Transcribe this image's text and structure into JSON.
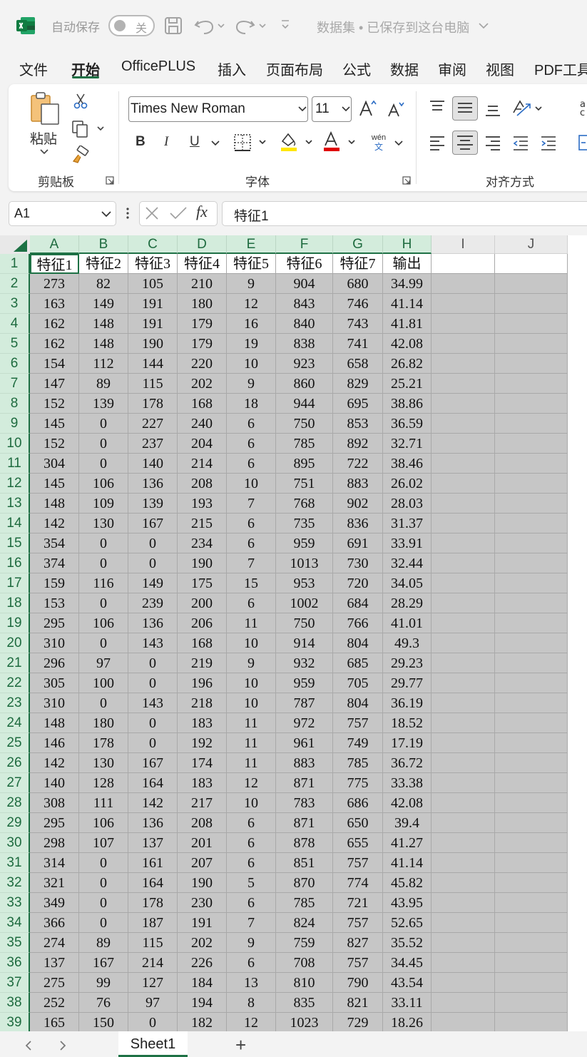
{
  "titlebar": {
    "app_icon": "excel-logo-icon",
    "autosave_label": "自动保存",
    "toggle_label": "关",
    "doc_title": "数据集 • 已保存到这台电脑"
  },
  "menu_tabs": [
    "文件",
    "开始",
    "OfficePLUS",
    "插入",
    "页面布局",
    "公式",
    "数据",
    "审阅",
    "视图",
    "PDF工具"
  ],
  "active_tab": "开始",
  "ribbon": {
    "clipboard": {
      "paste_label": "粘贴",
      "group_label": "剪贴板"
    },
    "font": {
      "font_name": "Times New Roman",
      "font_size": "11",
      "bold": "B",
      "italic": "I",
      "underline": "U",
      "phonetic_top": "wén",
      "phonetic_bottom": "文",
      "group_label": "字体"
    },
    "alignment": {
      "group_label": "对齐方式"
    },
    "accent_color": "#1e7145",
    "highlight_color": "#ffe600",
    "font_color": "#e00000"
  },
  "formula_bar": {
    "name_box": "A1",
    "fx_label": "fx",
    "formula": "特征1"
  },
  "grid": {
    "columns": [
      "A",
      "B",
      "C",
      "D",
      "E",
      "F",
      "G",
      "H",
      "I",
      "J"
    ],
    "header_row": [
      "特征1",
      "特征2",
      "特征3",
      "特征4",
      "特征5",
      "特征6",
      "特征7",
      "输出"
    ],
    "rows": [
      [
        "273",
        "82",
        "105",
        "210",
        "9",
        "904",
        "680",
        "34.99"
      ],
      [
        "163",
        "149",
        "191",
        "180",
        "12",
        "843",
        "746",
        "41.14"
      ],
      [
        "162",
        "148",
        "191",
        "179",
        "16",
        "840",
        "743",
        "41.81"
      ],
      [
        "162",
        "148",
        "190",
        "179",
        "19",
        "838",
        "741",
        "42.08"
      ],
      [
        "154",
        "112",
        "144",
        "220",
        "10",
        "923",
        "658",
        "26.82"
      ],
      [
        "147",
        "89",
        "115",
        "202",
        "9",
        "860",
        "829",
        "25.21"
      ],
      [
        "152",
        "139",
        "178",
        "168",
        "18",
        "944",
        "695",
        "38.86"
      ],
      [
        "145",
        "0",
        "227",
        "240",
        "6",
        "750",
        "853",
        "36.59"
      ],
      [
        "152",
        "0",
        "237",
        "204",
        "6",
        "785",
        "892",
        "32.71"
      ],
      [
        "304",
        "0",
        "140",
        "214",
        "6",
        "895",
        "722",
        "38.46"
      ],
      [
        "145",
        "106",
        "136",
        "208",
        "10",
        "751",
        "883",
        "26.02"
      ],
      [
        "148",
        "109",
        "139",
        "193",
        "7",
        "768",
        "902",
        "28.03"
      ],
      [
        "142",
        "130",
        "167",
        "215",
        "6",
        "735",
        "836",
        "31.37"
      ],
      [
        "354",
        "0",
        "0",
        "234",
        "6",
        "959",
        "691",
        "33.91"
      ],
      [
        "374",
        "0",
        "0",
        "190",
        "7",
        "1013",
        "730",
        "32.44"
      ],
      [
        "159",
        "116",
        "149",
        "175",
        "15",
        "953",
        "720",
        "34.05"
      ],
      [
        "153",
        "0",
        "239",
        "200",
        "6",
        "1002",
        "684",
        "28.29"
      ],
      [
        "295",
        "106",
        "136",
        "206",
        "11",
        "750",
        "766",
        "41.01"
      ],
      [
        "310",
        "0",
        "143",
        "168",
        "10",
        "914",
        "804",
        "49.3"
      ],
      [
        "296",
        "97",
        "0",
        "219",
        "9",
        "932",
        "685",
        "29.23"
      ],
      [
        "305",
        "100",
        "0",
        "196",
        "10",
        "959",
        "705",
        "29.77"
      ],
      [
        "310",
        "0",
        "143",
        "218",
        "10",
        "787",
        "804",
        "36.19"
      ],
      [
        "148",
        "180",
        "0",
        "183",
        "11",
        "972",
        "757",
        "18.52"
      ],
      [
        "146",
        "178",
        "0",
        "192",
        "11",
        "961",
        "749",
        "17.19"
      ],
      [
        "142",
        "130",
        "167",
        "174",
        "11",
        "883",
        "785",
        "36.72"
      ],
      [
        "140",
        "128",
        "164",
        "183",
        "12",
        "871",
        "775",
        "33.38"
      ],
      [
        "308",
        "111",
        "142",
        "217",
        "10",
        "783",
        "686",
        "42.08"
      ],
      [
        "295",
        "106",
        "136",
        "208",
        "6",
        "871",
        "650",
        "39.4"
      ],
      [
        "298",
        "107",
        "137",
        "201",
        "6",
        "878",
        "655",
        "41.27"
      ],
      [
        "314",
        "0",
        "161",
        "207",
        "6",
        "851",
        "757",
        "41.14"
      ],
      [
        "321",
        "0",
        "164",
        "190",
        "5",
        "870",
        "774",
        "45.82"
      ],
      [
        "349",
        "0",
        "178",
        "230",
        "6",
        "785",
        "721",
        "43.95"
      ],
      [
        "366",
        "0",
        "187",
        "191",
        "7",
        "824",
        "757",
        "52.65"
      ],
      [
        "274",
        "89",
        "115",
        "202",
        "9",
        "759",
        "827",
        "35.52"
      ],
      [
        "137",
        "167",
        "214",
        "226",
        "6",
        "708",
        "757",
        "34.45"
      ],
      [
        "275",
        "99",
        "127",
        "184",
        "13",
        "810",
        "790",
        "43.54"
      ],
      [
        "252",
        "76",
        "97",
        "194",
        "8",
        "835",
        "821",
        "33.11"
      ],
      [
        "165",
        "150",
        "0",
        "182",
        "12",
        "1023",
        "729",
        "18.26"
      ]
    ]
  },
  "sheets": {
    "active": "Sheet1",
    "add_label": "+"
  }
}
